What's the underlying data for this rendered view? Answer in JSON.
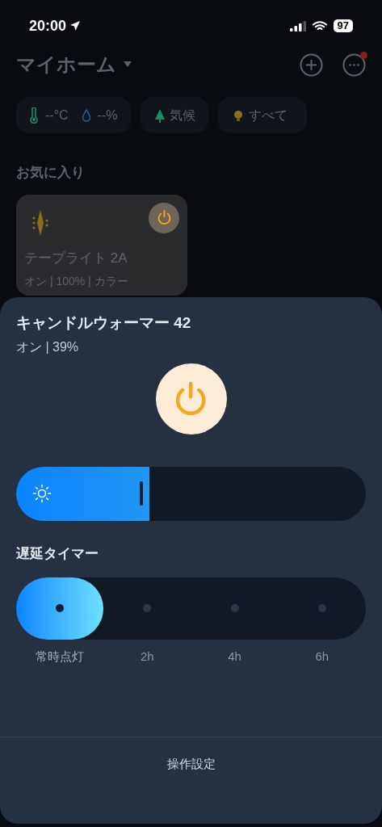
{
  "status_bar": {
    "time": "20:00",
    "battery": "97"
  },
  "header": {
    "title": "マイホーム",
    "notification_dot": true
  },
  "chips": [
    {
      "kind": "climate",
      "temperature": "--°C",
      "humidity": "--%"
    },
    {
      "kind": "weather",
      "label": "気候"
    },
    {
      "kind": "lights",
      "label": "すべて"
    }
  ],
  "favorites": {
    "title": "お気に入り",
    "devices": [
      {
        "name": "テープライト 2A",
        "status": "オン | 100% | カラー",
        "on": true
      }
    ]
  },
  "sheet": {
    "title": "キャンドルウォーマー 42",
    "status": "オン | 39%",
    "on": true,
    "brightness": {
      "level": 0.38
    },
    "timer": {
      "title": "遅延タイマー",
      "options": [
        {
          "label": "常時点灯",
          "selected": true
        },
        {
          "label": "2h",
          "selected": false
        },
        {
          "label": "4h",
          "selected": false
        },
        {
          "label": "6h",
          "selected": false
        }
      ]
    },
    "footer": "操作設定"
  }
}
